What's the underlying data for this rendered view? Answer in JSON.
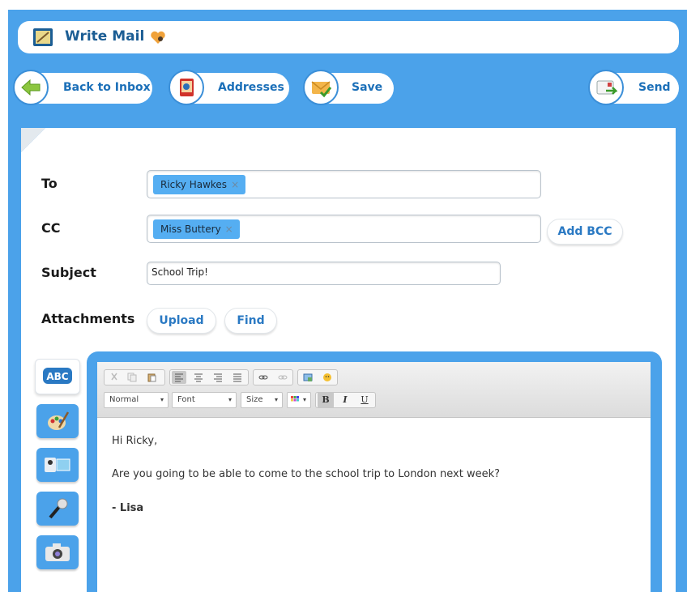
{
  "window": {
    "title": "Write Mail"
  },
  "toolbar": {
    "back_label": "Back to Inbox",
    "addresses_label": "Addresses",
    "save_label": "Save",
    "send_label": "Send"
  },
  "form": {
    "to_label": "To",
    "to_tag": "Ricky Hawkes",
    "cc_label": "CC",
    "cc_tag": "Miss Buttery",
    "tag_remove": "×",
    "add_bcc_label": "Add BCC",
    "subject_label": "Subject",
    "subject_value": "School Trip!",
    "attachments_label": "Attachments",
    "upload_label": "Upload",
    "find_label": "Find"
  },
  "sidebar": {
    "abc_label": "ABC"
  },
  "editor_toolbar": {
    "format_select": "Normal",
    "font_select": "Font",
    "size_select": "Size",
    "bold": "B",
    "italic": "I",
    "underline": "U",
    "dropdown_arrow": "▾"
  },
  "message": {
    "line1": "Hi Ricky,",
    "line2": "Are you going to be able to come to the school trip to London next week?",
    "line3": "- Lisa"
  },
  "colors": {
    "accent": "#4ba2ea",
    "label_blue": "#1b6fb8",
    "tag": "#55aef2"
  }
}
